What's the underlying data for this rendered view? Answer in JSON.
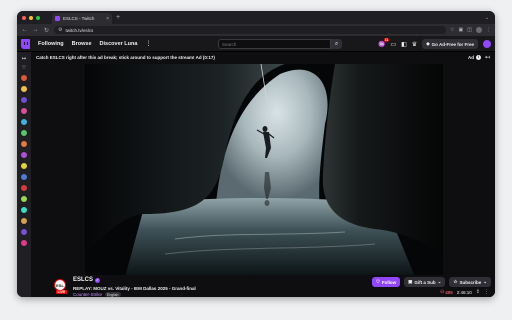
{
  "colors": {
    "twitch_purple": "#9147ff",
    "live_red": "#eb0400",
    "viewer_red": "#eb5757",
    "background": "#0e0e10"
  },
  "browser": {
    "tab_title": "ESLCS - Twitch",
    "url": "twitch.tv/eslcs"
  },
  "topnav": {
    "following": "Following",
    "browse": "Browse",
    "discover": "Discover Luna",
    "search_placeholder": "Search",
    "notification_count": "11",
    "ad_free_label": "Go Ad-Free for Free"
  },
  "ad": {
    "banner_text": "Catch ESLCS right after this ad break; stick around to support the stream! Ad (0:17)",
    "label": "Ad"
  },
  "channel": {
    "name": "ESLCS",
    "avatar_text": "ESL",
    "live_label": "LIVE",
    "title": "REPLAY: MOUZ vs. Vitality - IEM Dallas 2025 - Grand-final",
    "game": "Counter-Strike",
    "language": "English",
    "follow_label": "Follow",
    "gift_label": "Gift a Sub",
    "subscribe_label": "Subscribe",
    "viewers": "405",
    "uptime": "2:46:10"
  },
  "sidebar_avatars": [
    "#e0583b",
    "#f0c24b",
    "#6b4fd8",
    "#d84f9a",
    "#3fb0e0",
    "#58c76b",
    "#e07b3b",
    "#b04fd8",
    "#e0d43b",
    "#4f7bd8",
    "#d83b3b",
    "#9ad84f",
    "#3be0c2",
    "#d8a04f",
    "#7b4fd8",
    "#e03b8a"
  ]
}
